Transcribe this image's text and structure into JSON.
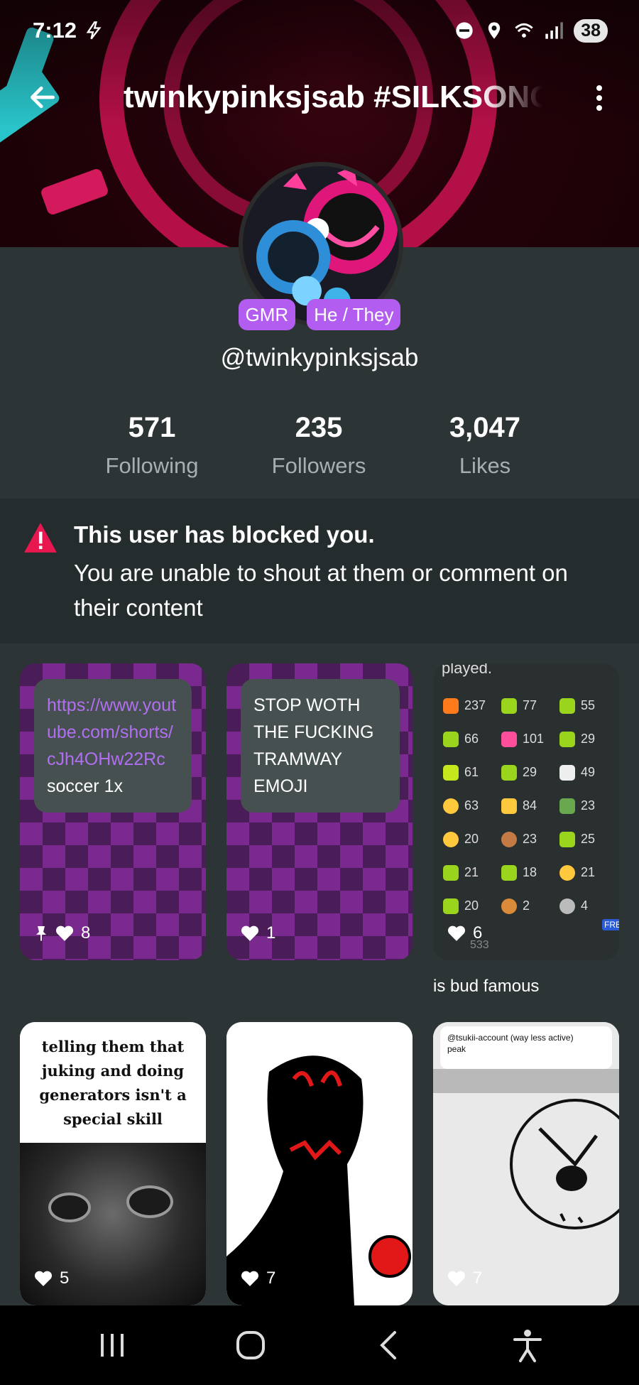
{
  "status_bar": {
    "time": "7:12",
    "battery": "38",
    "icons": [
      "flash-icon",
      "do-not-disturb-icon",
      "location-icon",
      "wifi-icon",
      "signal-icon"
    ]
  },
  "app_bar": {
    "title": "twinkypinksjsab #SILKSONG",
    "back_icon": "arrow-left-icon",
    "menu_icon": "more-vert-icon"
  },
  "profile": {
    "tags": [
      "GMR",
      "He / They"
    ],
    "handle": "@twinkypinksjsab",
    "stats": [
      {
        "value": "571",
        "label": "Following"
      },
      {
        "value": "235",
        "label": "Followers"
      },
      {
        "value": "3,047",
        "label": "Likes"
      }
    ]
  },
  "blocked_notice": {
    "title": "This user has blocked you.",
    "message": "You are unable to shout at them or comment on their content"
  },
  "posts": [
    {
      "link": "https://www.youtube.com/shorts/cJh4OHw22Rc",
      "text": "soccer 1x",
      "likes": "8",
      "pinned": true
    },
    {
      "text": "STOP WOTH THE FUCKING TRAMWAY EMOJI",
      "likes": "1"
    },
    {
      "top_text": "played.",
      "likes": "6",
      "caption": "is bud famous",
      "emoji_stats": [
        [
          "237",
          "77",
          "55"
        ],
        [
          "66",
          "101",
          "29"
        ],
        [
          "61",
          "29",
          "49"
        ],
        [
          "63",
          "84",
          "23"
        ],
        [
          "20",
          "23",
          "25"
        ],
        [
          "21",
          "18",
          "21"
        ],
        [
          "20",
          "2",
          "4"
        ]
      ],
      "footer_count": "533",
      "free_badge": "FREE"
    },
    {
      "text": "telling them that juking and doing generators isn't a special skill",
      "likes": "5"
    },
    {
      "likes": "7"
    },
    {
      "header": "@tsukii-account (way less active)",
      "sub": "peak",
      "likes": "7"
    }
  ],
  "colors": {
    "background": "#2d3436",
    "accent_tag": "#b35cf0",
    "link": "#b06ff0",
    "warning": "#e8174f"
  }
}
